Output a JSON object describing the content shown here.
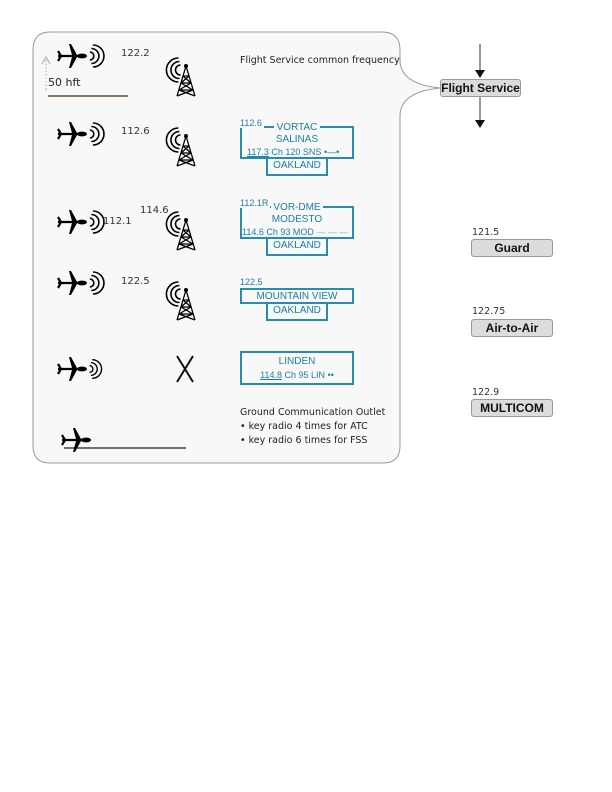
{
  "flight_service": {
    "label": "Flight Service",
    "common_frequency_note": "Flight Service common frequency"
  },
  "altitude_marker": "50 hft",
  "rows": [
    {
      "aircraft_freq": "122.2",
      "station": "tower",
      "station_freq": "",
      "navaid": null
    },
    {
      "aircraft_freq": "112.6",
      "station": "tower",
      "station_freq": "",
      "navaid": {
        "corner_freq": "112.6",
        "type": "VORTAC",
        "name": "SALINAS",
        "freq": "117.3",
        "channel": "Ch 120",
        "ident": "SNS",
        "morse": "•—•",
        "fss": "OAKLAND"
      }
    },
    {
      "aircraft_freq": "112.1",
      "station": "tower",
      "station_freq": "114.6",
      "navaid": {
        "corner_freq": "112.1R",
        "type": "VOR-DME",
        "name": "MODESTO",
        "freq": "114.6",
        "channel": "Ch 93",
        "ident": "MOD",
        "morse": "— — —",
        "fss": "OAKLAND"
      }
    },
    {
      "aircraft_freq": "122.5",
      "station": "tower",
      "station_freq": "",
      "navaid": {
        "corner_freq": "122.5",
        "name": "MOUNTAIN VIEW",
        "fss": "OAKLAND"
      }
    },
    {
      "aircraft_freq": "",
      "station": "none",
      "station_freq": "",
      "navaid": {
        "name": "LINDEN",
        "freq": "114.8",
        "channel": "Ch 95",
        "ident": "LIN",
        "morse": "••"
      }
    }
  ],
  "gco": {
    "title": "Ground Communication Outlet",
    "bullets": [
      "key radio 4 times for ATC",
      "key radio 6 times for FSS"
    ]
  },
  "frequencies": [
    {
      "freq": "121.5",
      "label": "Guard"
    },
    {
      "freq": "122.75",
      "label": "Air-to-Air"
    },
    {
      "freq": "122.9",
      "label": "MULTICOM"
    }
  ],
  "colors": {
    "navaid_blue": "#2a8bb0",
    "runway_glow": "#e8a060",
    "pill_bg": "#dcdcdc"
  }
}
